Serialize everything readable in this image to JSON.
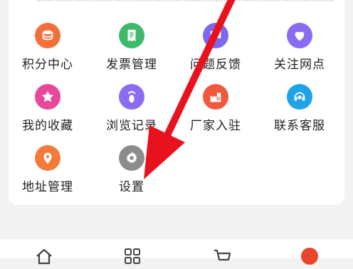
{
  "menu": {
    "items": [
      {
        "label": "积分中心",
        "icon": "coins-icon",
        "color": "#f4703a"
      },
      {
        "label": "发票管理",
        "icon": "invoice-icon",
        "color": "#3fba6a"
      },
      {
        "label": "问题反馈",
        "icon": "feedback-icon",
        "color": "#7b68ee"
      },
      {
        "label": "关注网点",
        "icon": "heart-icon",
        "color": "#8a6cf0"
      },
      {
        "label": "我的收藏",
        "icon": "star-icon",
        "color": "#e8479a"
      },
      {
        "label": "浏览记录",
        "icon": "footprint-icon",
        "color": "#8a6cf0"
      },
      {
        "label": "厂家入驻",
        "icon": "factory-icon",
        "color": "#f0593e"
      },
      {
        "label": "联系客服",
        "icon": "headset-icon",
        "color": "#1fa3e8"
      },
      {
        "label": "地址管理",
        "icon": "location-pin-icon",
        "color": "#f47a3a"
      },
      {
        "label": "设置",
        "icon": "gear-icon",
        "color": "#8c8c8c"
      }
    ]
  },
  "tabbar": {
    "tabs": [
      {
        "icon": "home-icon"
      },
      {
        "icon": "category-icon"
      },
      {
        "icon": "cart-icon"
      },
      {
        "icon": "profile-icon",
        "color": "#e8452c"
      }
    ]
  },
  "overlay": {
    "arrow_color": "#e8121e"
  }
}
